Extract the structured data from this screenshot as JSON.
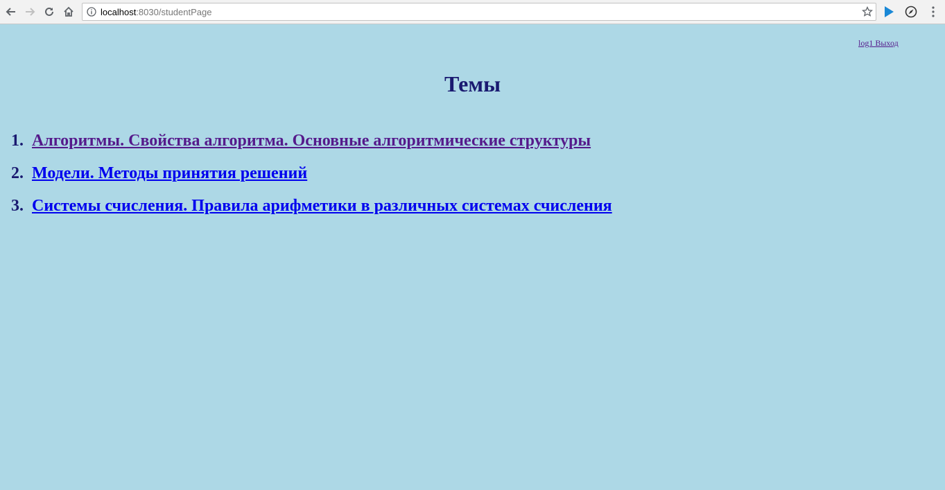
{
  "browser": {
    "url_host": "localhost",
    "url_rest": ":8030/studentPage"
  },
  "header": {
    "user_link": "log1 Выход"
  },
  "main": {
    "title": "Темы",
    "topics": [
      {
        "number": "1.",
        "label": "Алгоритмы. Свойства алгоритма. Основные алгоритмические структуры"
      },
      {
        "number": "2.",
        "label": "Модели. Методы принятия решений"
      },
      {
        "number": "3.",
        "label": "Системы счисления. Правила арифметики в различных системах счисления"
      }
    ]
  },
  "colors": {
    "background": "#add8e6",
    "title": "#191970",
    "link": "#0000ee",
    "visited_link": "#551a8b"
  }
}
